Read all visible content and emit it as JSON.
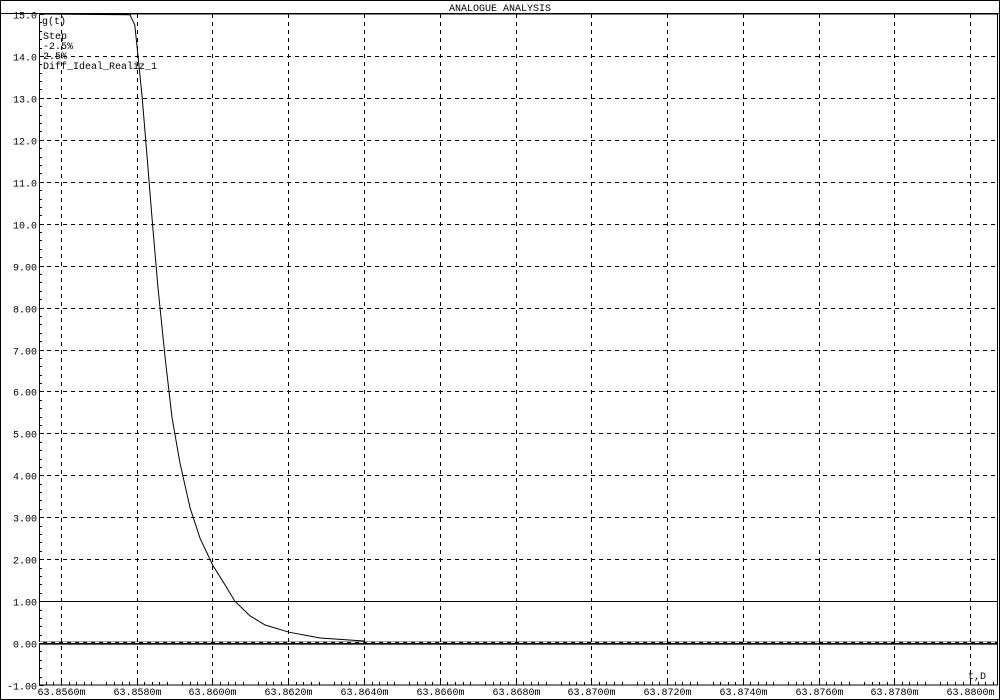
{
  "window": {
    "title": "ANALOGUE ANALYSIS"
  },
  "chart_data": {
    "type": "line",
    "title": "ANALOGUE ANALYSIS",
    "ylabel": "g(t)",
    "xlabel": "t,s",
    "xlabel_display": "t,D",
    "xlim": [
      63.85542,
      63.88071
    ],
    "ylim": [
      -1.0,
      15.0
    ],
    "grid": true,
    "x_ticks": [
      63.856,
      63.858,
      63.86,
      63.862,
      63.864,
      63.866,
      63.868,
      63.87,
      63.872,
      63.874,
      63.876,
      63.878,
      63.88
    ],
    "x_tick_labels": [
      "63.8560m",
      "63.8580m",
      "63.8600m",
      "63.8620m",
      "63.8640m",
      "63.8660m",
      "63.8680m",
      "63.8700m",
      "63.8720m",
      "63.8740m",
      "63.8760m",
      "63.8780m",
      "63.8800m"
    ],
    "y_ticks": [
      15,
      14,
      13,
      12,
      11,
      10,
      9,
      8,
      7,
      6,
      5,
      4,
      3,
      2,
      1,
      0,
      -1
    ],
    "y_tick_labels": [
      "15.0",
      "14.0",
      "13.0",
      "12.0",
      "11.0",
      "10.0",
      "9.00",
      "8.00",
      "7.00",
      "6.00",
      "5.00",
      "4.00",
      "3.00",
      "2.00",
      "1.00",
      "0.00",
      "-1.00"
    ],
    "legend": {
      "lines": [
        "Step",
        "-2.5%",
        "2.5%",
        "Diff_Ideal_Realiz_1"
      ],
      "placement": "top-left"
    },
    "series": [
      {
        "name": "Diff_Ideal_Realiz_1",
        "x": [
          63.85545,
          63.85782,
          63.85795,
          63.85803,
          63.85814,
          63.85827,
          63.8584,
          63.85856,
          63.85875,
          63.85893,
          63.85914,
          63.85941,
          63.85967,
          63.86001,
          63.86033,
          63.86059,
          63.86099,
          63.86139,
          63.86202,
          63.86284,
          63.864
        ],
        "y": [
          15.0,
          14.98,
          14.74,
          14.02,
          13.06,
          11.62,
          10.17,
          8.49,
          6.81,
          5.38,
          4.3,
          3.22,
          2.5,
          1.85,
          1.39,
          1.0,
          0.65,
          0.43,
          0.26,
          0.12,
          0.05
        ]
      },
      {
        "name": "Step",
        "x": [
          63.85542,
          63.88071
        ],
        "y": [
          0,
          0
        ]
      }
    ],
    "reference_lines": [
      {
        "name": "upper",
        "y": 1.0
      }
    ]
  }
}
